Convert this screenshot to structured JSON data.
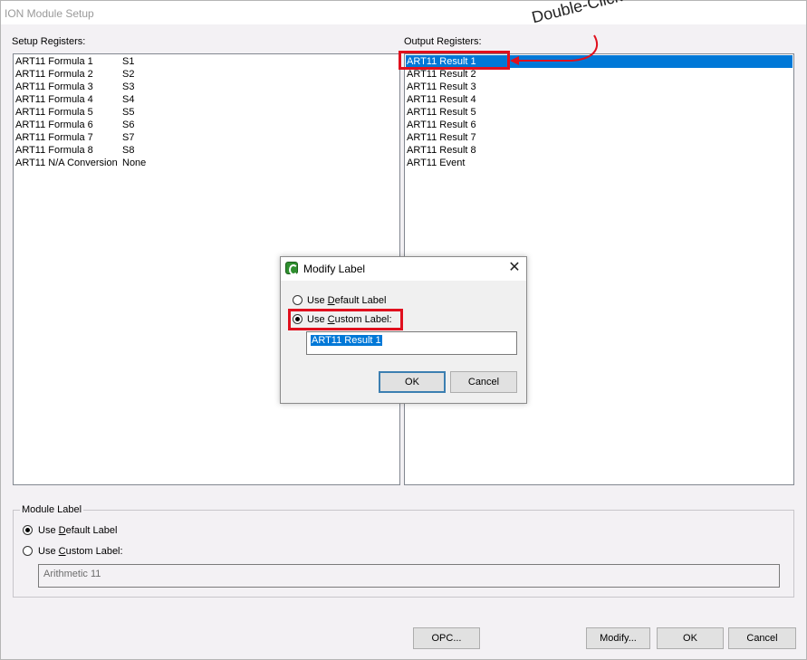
{
  "window": {
    "title": "ION Module Setup"
  },
  "setup_registers": {
    "label": "Setup Registers:",
    "items": [
      {
        "name": "ART11 Formula 1",
        "value": "S1"
      },
      {
        "name": "ART11 Formula 2",
        "value": "S2"
      },
      {
        "name": "ART11 Formula 3",
        "value": "S3"
      },
      {
        "name": "ART11 Formula 4",
        "value": "S4"
      },
      {
        "name": "ART11 Formula 5",
        "value": "S5"
      },
      {
        "name": "ART11 Formula 6",
        "value": "S6"
      },
      {
        "name": "ART11 Formula 7",
        "value": "S7"
      },
      {
        "name": "ART11 Formula 8",
        "value": "S8"
      },
      {
        "name": "ART11 N/A Conversion",
        "value": "None"
      }
    ]
  },
  "output_registers": {
    "label": "Output Registers:",
    "items": [
      "ART11 Result 1",
      "ART11 Result 2",
      "ART11 Result 3",
      "ART11 Result 4",
      "ART11 Result 5",
      "ART11 Result 6",
      "ART11 Result 7",
      "ART11 Result 8",
      "ART11 Event"
    ],
    "selected": "ART11 Result 1"
  },
  "annotation": {
    "text": "Double-Click",
    "highlight_color": "#e0101e"
  },
  "module_label": {
    "legend": "Module Label",
    "default_option": {
      "pre": "Use ",
      "key": "D",
      "post": "efault Label"
    },
    "custom_option": {
      "pre": "Use ",
      "key": "C",
      "post": "ustom Label:"
    },
    "selected": "default",
    "custom_value": "Arithmetic 11"
  },
  "buttons": {
    "opc": "OPC...",
    "modify": "Modify...",
    "ok": "OK",
    "cancel": "Cancel"
  },
  "modify_dialog": {
    "title": "Modify Label",
    "default_option": {
      "pre": "Use ",
      "key": "D",
      "post": "efault Label"
    },
    "custom_option": {
      "pre": "Use ",
      "key": "C",
      "post": "ustom Label:"
    },
    "selected": "custom",
    "custom_value": "ART11 Result 1",
    "ok_label": "OK",
    "cancel_label": "Cancel",
    "close_glyph": "✕"
  },
  "colors": {
    "selection": "#0078d7",
    "highlight": "#e0101e",
    "accent": "#3c7fb1"
  }
}
